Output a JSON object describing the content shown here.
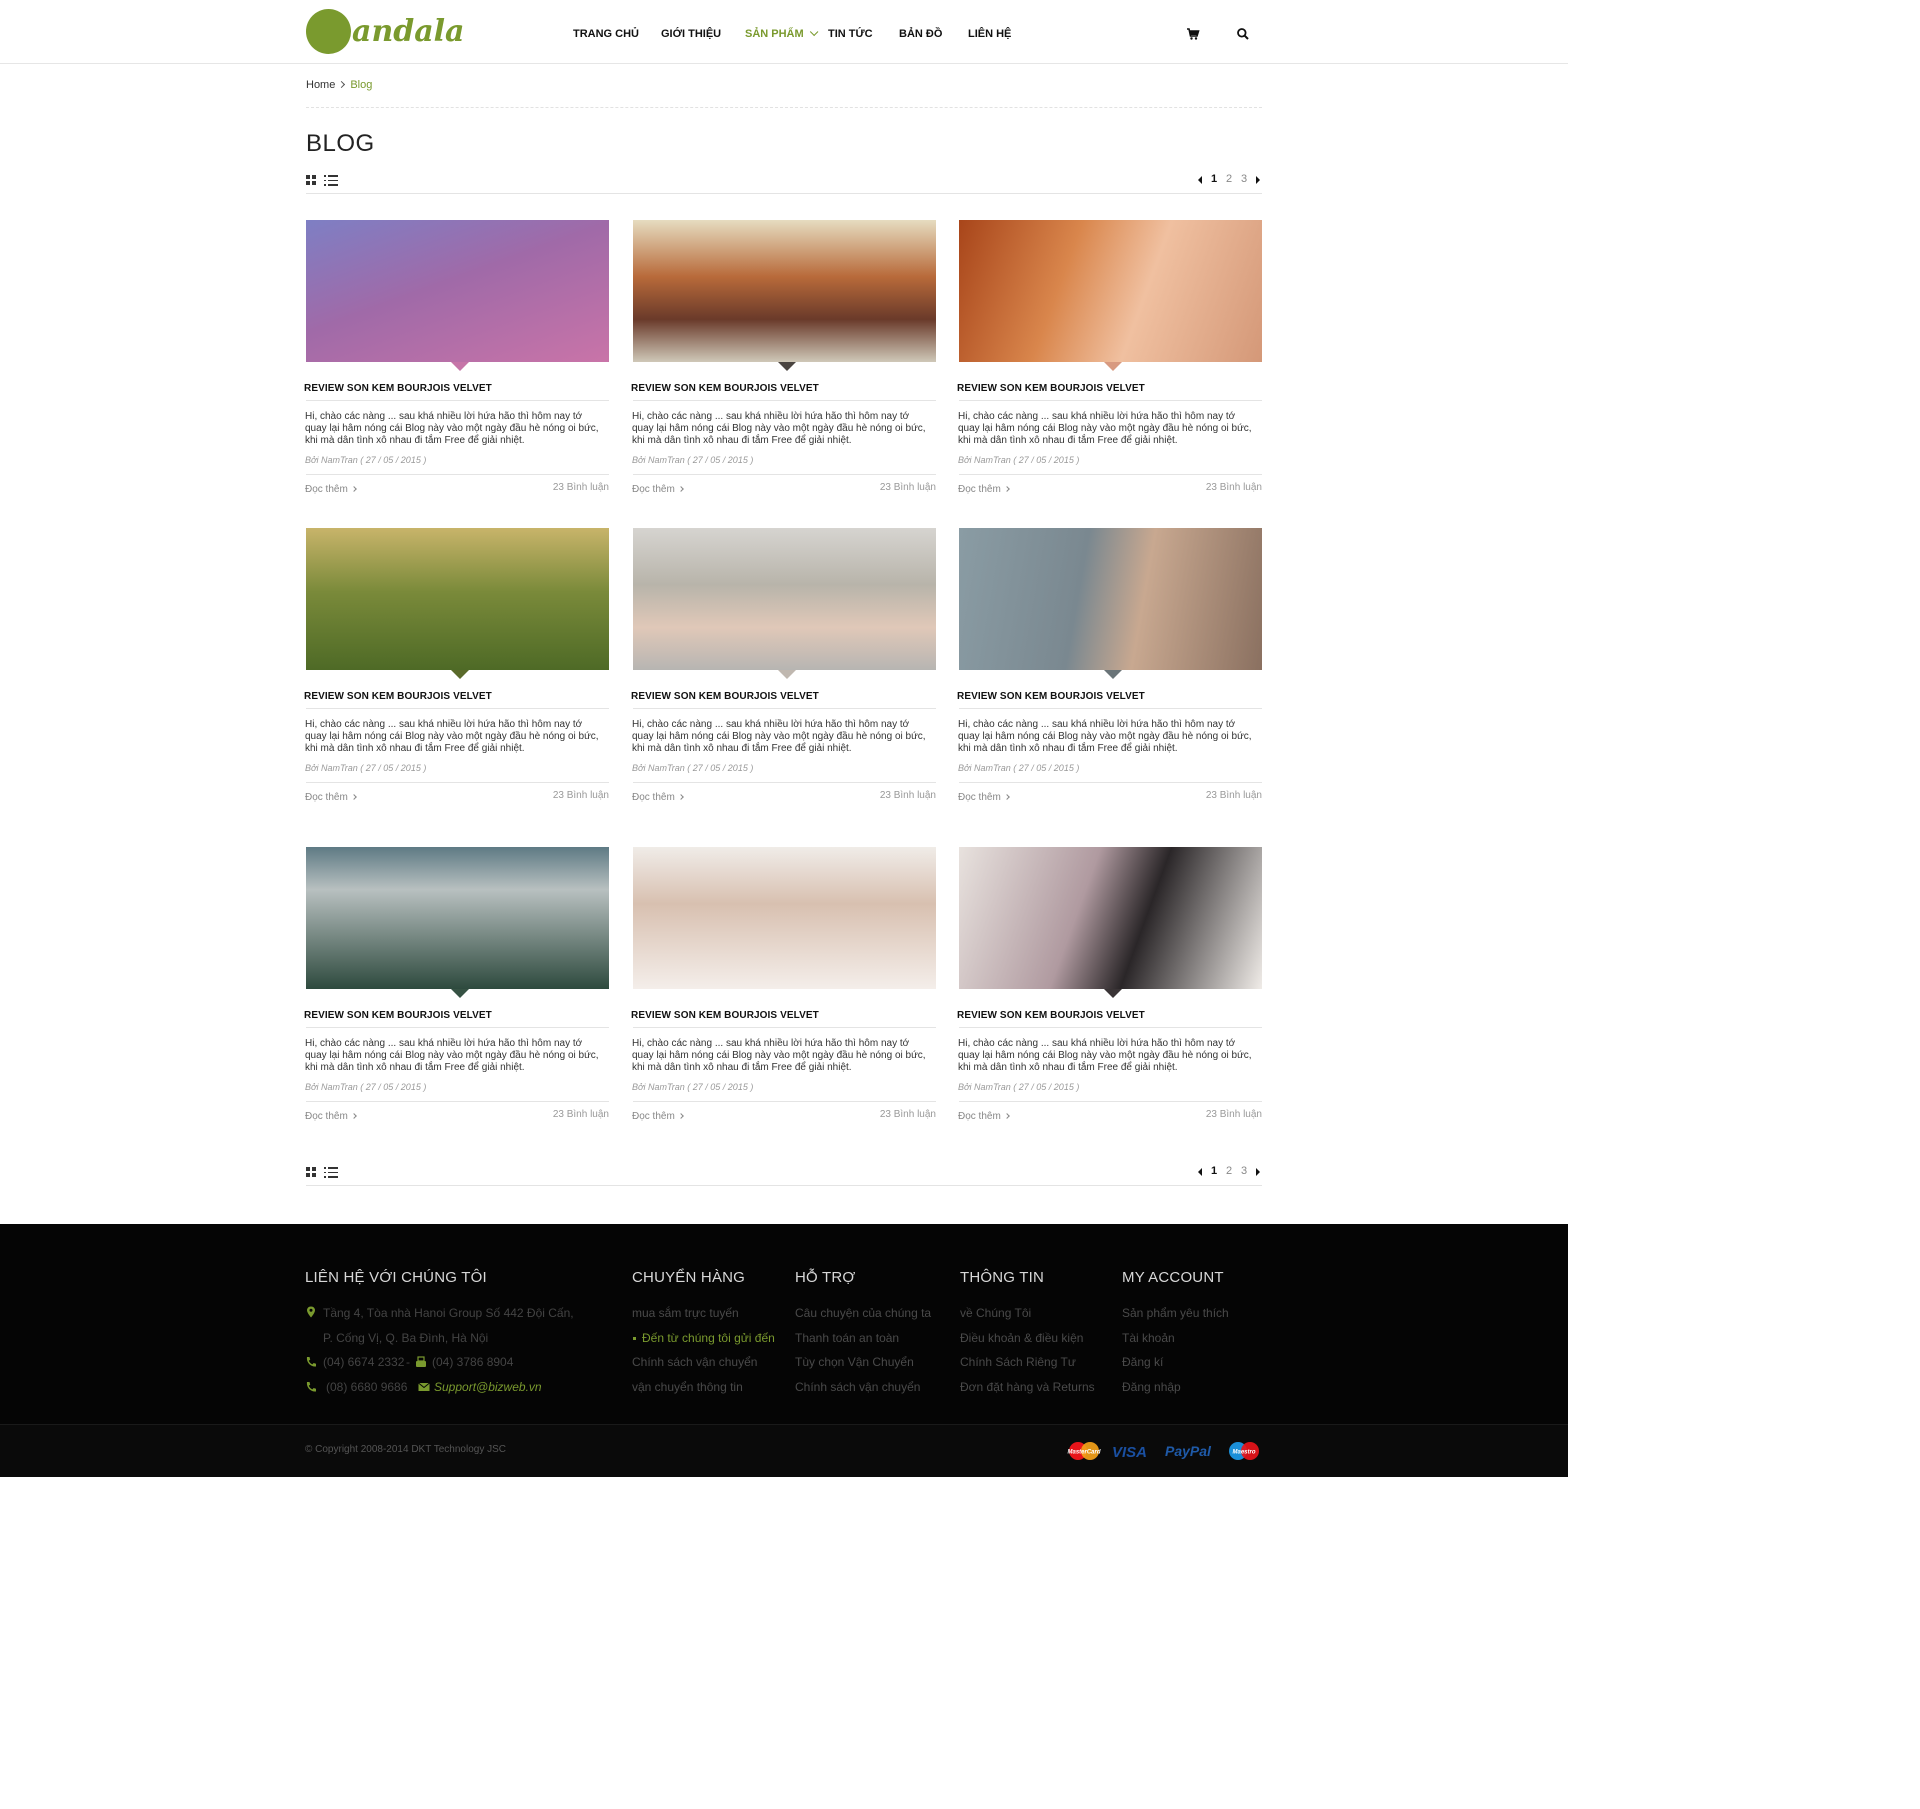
{
  "header": {
    "logo_text": "andala",
    "nav": [
      {
        "label": "TRANG CHỦ",
        "active": false
      },
      {
        "label": "GIỚI THIỆU",
        "active": false
      },
      {
        "label": "SẢN PHẨM",
        "active": true,
        "has_dropdown": true
      },
      {
        "label": "TIN TỨC",
        "active": false
      },
      {
        "label": "BẢN ĐỒ",
        "active": false
      },
      {
        "label": "LIÊN HỆ",
        "active": false
      }
    ],
    "icons": [
      "cart-icon",
      "search-icon"
    ]
  },
  "breadcrumb": {
    "home": "Home",
    "current": "Blog"
  },
  "page_title": "BLOG",
  "pagination": {
    "pages": [
      "1",
      "2",
      "3"
    ],
    "current": "1"
  },
  "posts": [
    {
      "title": "REVIEW SON KEM BOURJOIS VELVET",
      "excerpt": "Hi, chào các nàng ... sau khá nhiều lời hứa hão thì hôm nay tớ quay lại hâm nóng cái Blog này vào một ngày đầu hè nóng oi bức, khi mà dân tình xô nhau đi tắm Free để giải nhiệt.",
      "meta": "Bởi NamTran ( 27 / 05 / 2015 )",
      "read_more": "Đọc thêm",
      "comments": "23 Bình luận"
    },
    {
      "title": "REVIEW SON KEM BOURJOIS VELVET",
      "excerpt": "Hi, chào các nàng ... sau khá nhiều lời hứa hão thì hôm nay tớ quay lại hâm nóng cái Blog này vào một ngày đầu hè nóng oi bức, khi mà dân tình xô nhau đi tắm Free để giải nhiệt.",
      "meta": "Bởi NamTran ( 27 / 05 / 2015 )",
      "read_more": "Đọc thêm",
      "comments": "23 Bình luận"
    },
    {
      "title": "REVIEW SON KEM BOURJOIS VELVET",
      "excerpt": "Hi, chào các nàng ... sau khá nhiều lời hứa hão thì hôm nay tớ quay lại hâm nóng cái Blog này vào một ngày đầu hè nóng oi bức, khi mà dân tình xô nhau đi tắm Free để giải nhiệt.",
      "meta": "Bởi NamTran ( 27 / 05 / 2015 )",
      "read_more": "Đọc thêm",
      "comments": "23 Bình luận"
    },
    {
      "title": "REVIEW SON KEM BOURJOIS VELVET",
      "excerpt": "Hi, chào các nàng ... sau khá nhiều lời hứa hão thì hôm nay tớ quay lại hâm nóng cái Blog này vào một ngày đầu hè nóng oi bức, khi mà dân tình xô nhau đi tắm Free để giải nhiệt.",
      "meta": "Bởi NamTran ( 27 / 05 / 2015 )",
      "read_more": "Đọc thêm",
      "comments": "23 Bình luận"
    },
    {
      "title": "REVIEW SON KEM BOURJOIS VELVET",
      "excerpt": "Hi, chào các nàng ... sau khá nhiều lời hứa hão thì hôm nay tớ quay lại hâm nóng cái Blog này vào một ngày đầu hè nóng oi bức, khi mà dân tình xô nhau đi tắm Free để giải nhiệt.",
      "meta": "Bởi NamTran ( 27 / 05 / 2015 )",
      "read_more": "Đọc thêm",
      "comments": "23 Bình luận"
    },
    {
      "title": "REVIEW SON KEM BOURJOIS VELVET",
      "excerpt": "Hi, chào các nàng ... sau khá nhiều lời hứa hão thì hôm nay tớ quay lại hâm nóng cái Blog này vào một ngày đầu hè nóng oi bức, khi mà dân tình xô nhau đi tắm Free để giải nhiệt.",
      "meta": "Bởi NamTran ( 27 / 05 / 2015 )",
      "read_more": "Đọc thêm",
      "comments": "23 Bình luận"
    },
    {
      "title": "REVIEW SON KEM BOURJOIS VELVET",
      "excerpt": "Hi, chào các nàng ... sau khá nhiều lời hứa hão thì hôm nay tớ quay lại hâm nóng cái Blog này vào một ngày đầu hè nóng oi bức, khi mà dân tình xô nhau đi tắm Free để giải nhiệt.",
      "meta": "Bởi NamTran ( 27 / 05 / 2015 )",
      "read_more": "Đọc thêm",
      "comments": "23 Bình luận"
    },
    {
      "title": "REVIEW SON KEM BOURJOIS VELVET",
      "excerpt": "Hi, chào các nàng ... sau khá nhiều lời hứa hão thì hôm nay tớ quay lại hâm nóng cái Blog này vào một ngày đầu hè nóng oi bức, khi mà dân tình xô nhau đi tắm Free để giải nhiệt.",
      "meta": "Bởi NamTran ( 27 / 05 / 2015 )",
      "read_more": "Đọc thêm",
      "comments": "23 Bình luận"
    },
    {
      "title": "REVIEW SON KEM BOURJOIS VELVET",
      "excerpt": "Hi, chào các nàng ... sau khá nhiều lời hứa hão thì hôm nay tớ quay lại hâm nóng cái Blog này vào một ngày đầu hè nóng oi bức, khi mà dân tình xô nhau đi tắm Free để giải nhiệt.",
      "meta": "Bởi NamTran ( 27 / 05 / 2015 )",
      "read_more": "Đọc thêm",
      "comments": "23 Bình luận"
    }
  ],
  "footer": {
    "contact": {
      "title": "LIÊN HỆ VỚI CHÚNG TÔI",
      "address_line1": "Tầng 4, Tòa nhà Hanoi Group  Số 442 Đội Cấn,",
      "address_line2": "P. Cống Vị, Q. Ba Đình, Hà Nội",
      "phone1": "(04) 6674 2332",
      "separator": "-",
      "phone2": "(04) 3786 8904",
      "phone3": "(08) 6680 9686",
      "email": "Support@bizweb.vn"
    },
    "columns": [
      {
        "title": "CHUYỂN HÀNG",
        "links": [
          "mua sắm trực tuyến",
          "Đến từ chúng tôi gửi đến",
          "Chính sách vận chuyển",
          "vận chuyển thông tin"
        ],
        "active_index": 1
      },
      {
        "title": "HỖ TRỢ",
        "links": [
          "Câu chuyện của chúng ta",
          "Thanh toán an toàn",
          "Tùy chọn Vận Chuyển",
          "Chính sách vận chuyển"
        ],
        "active_index": -1
      },
      {
        "title": "THÔNG TIN",
        "links": [
          "về Chúng Tôi",
          "Điều khoản & điều kiện",
          "Chính Sách Riêng Tư",
          "Đơn đặt hàng và Returns"
        ],
        "active_index": -1
      },
      {
        "title": "MY ACCOUNT",
        "links": [
          "Sản phẩm yêu thích",
          "Tài khoản",
          "Đăng kí",
          "Đăng nhập"
        ],
        "active_index": -1
      }
    ],
    "copyright": "© Copyright 2008-2014 DKT Technology JSC",
    "payments": [
      "MasterCard",
      "VISA",
      "PayPal",
      "Maestro"
    ]
  },
  "colors": {
    "accent": "#7a9a2e",
    "footer_bg": "#050505"
  }
}
